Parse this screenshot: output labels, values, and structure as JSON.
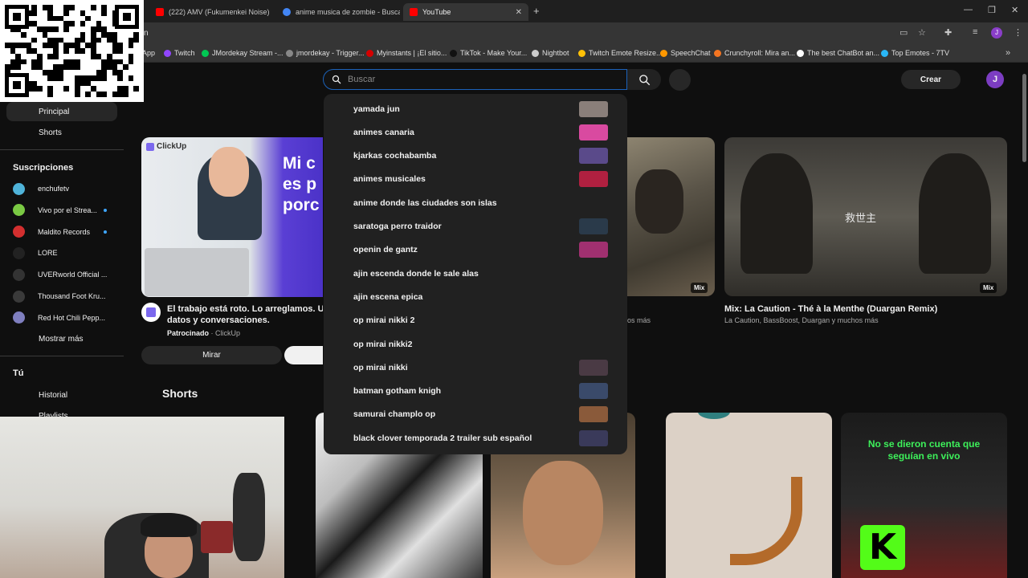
{
  "browser": {
    "tabs": [
      {
        "label": "(222) AMV (Fukumenkei Noise)",
        "color": "#ff0000"
      },
      {
        "label": "anime musica de zombie - Buscar",
        "color": "#4285f4"
      },
      {
        "label": "YouTube",
        "color": "#ff0000"
      }
    ],
    "url_fragment": "n",
    "bookmarks": [
      {
        "label": "App",
        "color": "#555555"
      },
      {
        "label": "Twitch",
        "color": "#9146ff"
      },
      {
        "label": "JMordekay Stream -...",
        "color": "#00c853"
      },
      {
        "label": "jmordekay - Trigger...",
        "color": "#888888"
      },
      {
        "label": "Myinstants | ¡El sitio...",
        "color": "#d50000"
      },
      {
        "label": "TikTok - Make Your...",
        "color": "#111111"
      },
      {
        "label": "Nightbot",
        "color": "#cccccc"
      },
      {
        "label": "Twitch Emote Resize...",
        "color": "#ffc107"
      },
      {
        "label": "SpeechChat",
        "color": "#ff9800"
      },
      {
        "label": "Crunchyroll: Mira an...",
        "color": "#f47521"
      },
      {
        "label": "The best ChatBot an...",
        "color": "#ffffff"
      },
      {
        "label": "Top Emotes - 7TV",
        "color": "#29b6f6"
      }
    ]
  },
  "header": {
    "search_placeholder": "Buscar",
    "create_label": "Crear",
    "avatar_letter": "J"
  },
  "sidebar": {
    "main_items": [
      {
        "label": "Principal"
      },
      {
        "label": "Shorts"
      }
    ],
    "subscriptions_heading": "Suscripciones",
    "subscriptions": [
      {
        "label": "enchufetv",
        "color": "#4fb3d9",
        "live": false
      },
      {
        "label": "Vivo por el Strea...",
        "color": "#7ac943",
        "live": true
      },
      {
        "label": "Maldito Records",
        "color": "#d32f2f",
        "live": true
      },
      {
        "label": "LORE",
        "color": "#222222",
        "live": false
      },
      {
        "label": "UVERworld Official ...",
        "color": "#333333",
        "live": false
      },
      {
        "label": "Thousand Foot Kru...",
        "color": "#3a3a3a",
        "live": false
      },
      {
        "label": "Red Hot Chili Pepp...",
        "color": "#7f7fbf",
        "live": false
      }
    ],
    "show_more_label": "Mostrar más",
    "you_heading": "Tú",
    "you_items": [
      {
        "label": "Historial"
      },
      {
        "label": "Playlists"
      }
    ]
  },
  "videos": [
    {
      "title_line1": "El trabajo está roto. Lo arreglamos. Una a",
      "title_line2": "datos y conversaciones.",
      "sponsored_label": "Patrocinado",
      "channel": "ClickUp",
      "brand_label": "ClickUp",
      "overlay_text": "Mi c es p porc",
      "action_label": "Mirar"
    },
    {
      "mix_label": "Mix",
      "meta_fragment": "os más"
    },
    {
      "title": "Mix: La Caution - Thé à la Menthe (Duargan Remix)",
      "meta": "La Caution, BassBoost, Duargan y muchos más",
      "mix_label": "Mix",
      "overlay_text": "救世主"
    }
  ],
  "shorts": {
    "heading": "Shorts",
    "overlay_text": "No se dieron cuenta que seguían en vivo"
  },
  "suggestions": [
    {
      "label": "yamada jun",
      "thumb": "#8a7f7a"
    },
    {
      "label": "animes canaria",
      "thumb": "#d94aa0"
    },
    {
      "label": "kjarkas cochabamba",
      "thumb": "#5a4a8a"
    },
    {
      "label": "animes musicales",
      "thumb": "#b02040"
    },
    {
      "label": "anime donde las ciudades son islas",
      "thumb": null
    },
    {
      "label": "saratoga perro traidor",
      "thumb": "#2a3a4a"
    },
    {
      "label": "openin de gantz",
      "thumb": "#a03070"
    },
    {
      "label": "ajin escenda donde le sale alas",
      "thumb": null
    },
    {
      "label": "ajin escena epica",
      "thumb": null
    },
    {
      "label": "op mirai nikki 2",
      "thumb": null
    },
    {
      "label": "op mirai nikki2",
      "thumb": null
    },
    {
      "label": "op mirai nikki",
      "thumb": "#4a3a44"
    },
    {
      "label": "batman gotham knigh",
      "thumb": "#3a4a6a"
    },
    {
      "label": "samurai champlo op",
      "thumb": "#8a5a3a"
    },
    {
      "label": "black clover temporada 2 trailer sub español",
      "thumb": "#3a3a5a"
    }
  ]
}
